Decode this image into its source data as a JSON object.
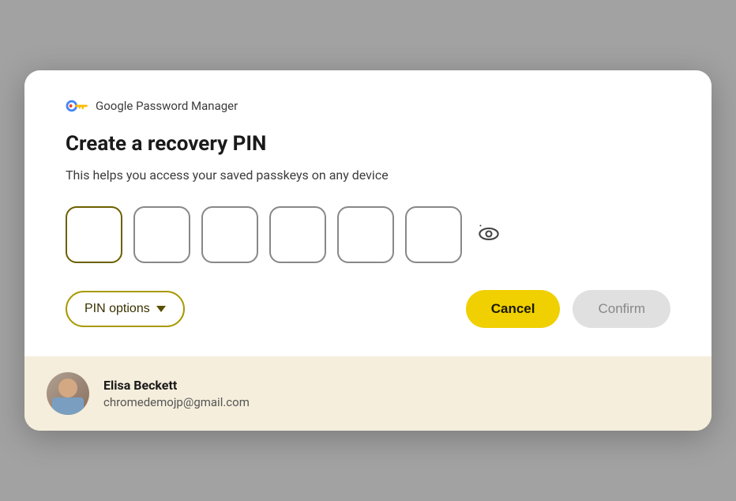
{
  "modal": {
    "header": {
      "app_name": "Google Password Manager",
      "key_icon_label": "google-key-icon"
    },
    "title": "Create a recovery PIN",
    "subtitle": "This helps you access your saved passkeys on any device",
    "pin_fields": [
      {
        "id": "pin1",
        "value": "",
        "placeholder": ""
      },
      {
        "id": "pin2",
        "value": "",
        "placeholder": ""
      },
      {
        "id": "pin3",
        "value": "",
        "placeholder": ""
      },
      {
        "id": "pin4",
        "value": "",
        "placeholder": ""
      },
      {
        "id": "pin5",
        "value": "",
        "placeholder": ""
      },
      {
        "id": "pin6",
        "value": "",
        "placeholder": ""
      }
    ],
    "eye_icon_label": "eye-icon",
    "buttons": {
      "pin_options_label": "PIN options",
      "cancel_label": "Cancel",
      "confirm_label": "Confirm"
    },
    "footer": {
      "user_name": "Elisa Beckett",
      "user_email": "chromedemojp@gmail.com"
    }
  },
  "colors": {
    "accent_olive": "#a89a00",
    "cancel_yellow": "#f0d000",
    "confirm_disabled": "#e0e0e0",
    "footer_bg": "#f5eedc"
  }
}
